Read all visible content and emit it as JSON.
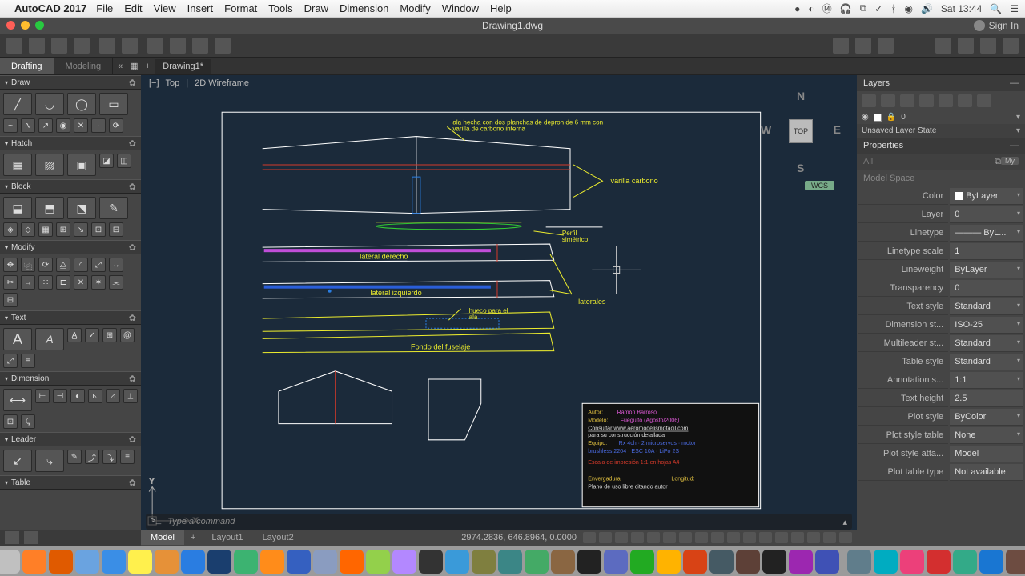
{
  "menubar": {
    "app": "AutoCAD 2017",
    "items": [
      "File",
      "Edit",
      "View",
      "Insert",
      "Format",
      "Tools",
      "Draw",
      "Dimension",
      "Modify",
      "Window",
      "Help"
    ],
    "clock": "Sat 13:44"
  },
  "window": {
    "title": "Drawing1.dwg",
    "signin": "Sign In"
  },
  "tabs": {
    "drafting": "Drafting",
    "modeling": "Modeling",
    "file": "Drawing1*"
  },
  "view": {
    "label1": "Top",
    "label2": "2D Wireframe",
    "cube": "TOP",
    "wcs": "WCS"
  },
  "cmd": {
    "placeholder": "Type a command"
  },
  "layout": {
    "model": "Model",
    "l1": "Layout1",
    "l2": "Layout2",
    "coords": "2974.2836, 646.8964, 0.0000",
    "scale": "1:1"
  },
  "left_sections": {
    "draw": "Draw",
    "hatch": "Hatch",
    "block": "Block",
    "modify": "Modify",
    "text": "Text",
    "dimension": "Dimension",
    "leader": "Leader",
    "table": "Table"
  },
  "right": {
    "layers_title": "Layers",
    "layer_zero": "0",
    "layer_state": "Unsaved Layer State",
    "props_title": "Properties",
    "my": "My",
    "context": "Model Space",
    "props": {
      "Color": "ByLayer",
      "Layer": "0",
      "Linetype": "ByL...",
      "Linetype scale": "1",
      "Lineweight": "ByLayer",
      "Transparency": "0",
      "Text style": "Standard",
      "Dimension st...": "ISO-25",
      "Multileader st...": "Standard",
      "Table style": "Standard",
      "Annotation s...": "1:1",
      "Text height": "2.5",
      "Plot style": "ByColor",
      "Plot style table": "None",
      "Plot style atta...": "Model",
      "Plot table type": "Not available"
    }
  },
  "drawing": {
    "note1": "ala hecha con dos planchas de depron de 6 mm con",
    "note2": "varilla de carbono interna",
    "varilla": "varilla carbono",
    "perfil1": "Perfil",
    "perfil2": "simétrico",
    "lat_der": "lateral derecho",
    "lat_izq": "lateral izquierdo",
    "hueco": "hueco para el",
    "ala": "ala",
    "laterales": "laterales",
    "fondo": "Fondo del fuselaje",
    "tb_autor_l": "Autor:",
    "tb_autor_v": "Ramón Barroso",
    "tb_modelo_l": "Modelo:",
    "tb_modelo_v": "Fueguito   (Agosto/2006)",
    "tb_web": "Consultar www.aeromodelismofacil.com",
    "tb_constr": "para su construcción detallada",
    "tb_equipo": "Equipo:",
    "tb_env": "Envergadura:",
    "tb_long": "Longitud:",
    "tb_libre": "Plano de uso libre citando autor"
  },
  "dock_colors": [
    "#4a90d9",
    "#c0c0c0",
    "#ff7f27",
    "#e05a00",
    "#6aa3e0",
    "#3a8ee6",
    "#fff04d",
    "#e69138",
    "#2a7de1",
    "#1a3e6e",
    "#3cb371",
    "#ff8c1a",
    "#3560c0",
    "#8a9cc0",
    "#ff6600",
    "#93d04b",
    "#b388ff",
    "#333333",
    "#3a9ad9",
    "#7f7f3f",
    "#3b8686",
    "#4a6",
    "#8a6642",
    "#222",
    "#5c6bc0",
    "#2a2",
    "#ffb300",
    "#d84315",
    "#455a64",
    "#5d4037",
    "#222",
    "#9c27b0",
    "#3f51b5",
    "#607d8b",
    "#00acc1",
    "#ec407a",
    "#d32f2f",
    "#3a8",
    "#1976d2",
    "#6d4c41",
    "#9e9e9e"
  ]
}
